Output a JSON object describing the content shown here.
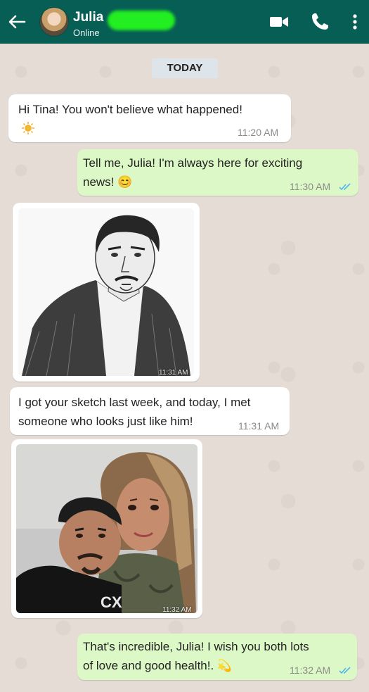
{
  "header": {
    "contact_name": "Julia",
    "status": "Online",
    "icons": [
      "back-arrow-icon",
      "video-call-icon",
      "phone-icon",
      "more-options-icon"
    ],
    "bg_color": "#075e54"
  },
  "chat": {
    "day_label": "TODAY",
    "messages": [
      {
        "dir": "in",
        "text": "Hi Tina! You won't believe what happened!",
        "emoji": "sun",
        "time": "11:20 AM"
      },
      {
        "dir": "out",
        "text_line1": "Tell me, Julia! I'm always here for exciting",
        "text_line2": "news! 😊",
        "time": "11:30 AM",
        "read": true
      },
      {
        "dir": "in",
        "type": "image",
        "content": "pencil sketch portrait of a man",
        "time": "11:31 AM"
      },
      {
        "dir": "in",
        "text_line1": "I got your sketch last week, and today, I met",
        "text_line2": "someone who looks just like him!",
        "time": "11:31 AM"
      },
      {
        "dir": "in",
        "type": "image",
        "content": "selfie photo of a man and a woman",
        "time": "11:32 AM"
      },
      {
        "dir": "out",
        "text_line1": "That's incredible, Julia! I wish you both lots",
        "text_line2": "of love and good health!. 💫",
        "time": "11:32 AM",
        "read": true
      }
    ]
  },
  "colors": {
    "incoming_bubble": "#ffffff",
    "outgoing_bubble": "#dcf8c6",
    "read_ticks": "#4fb6ec"
  }
}
